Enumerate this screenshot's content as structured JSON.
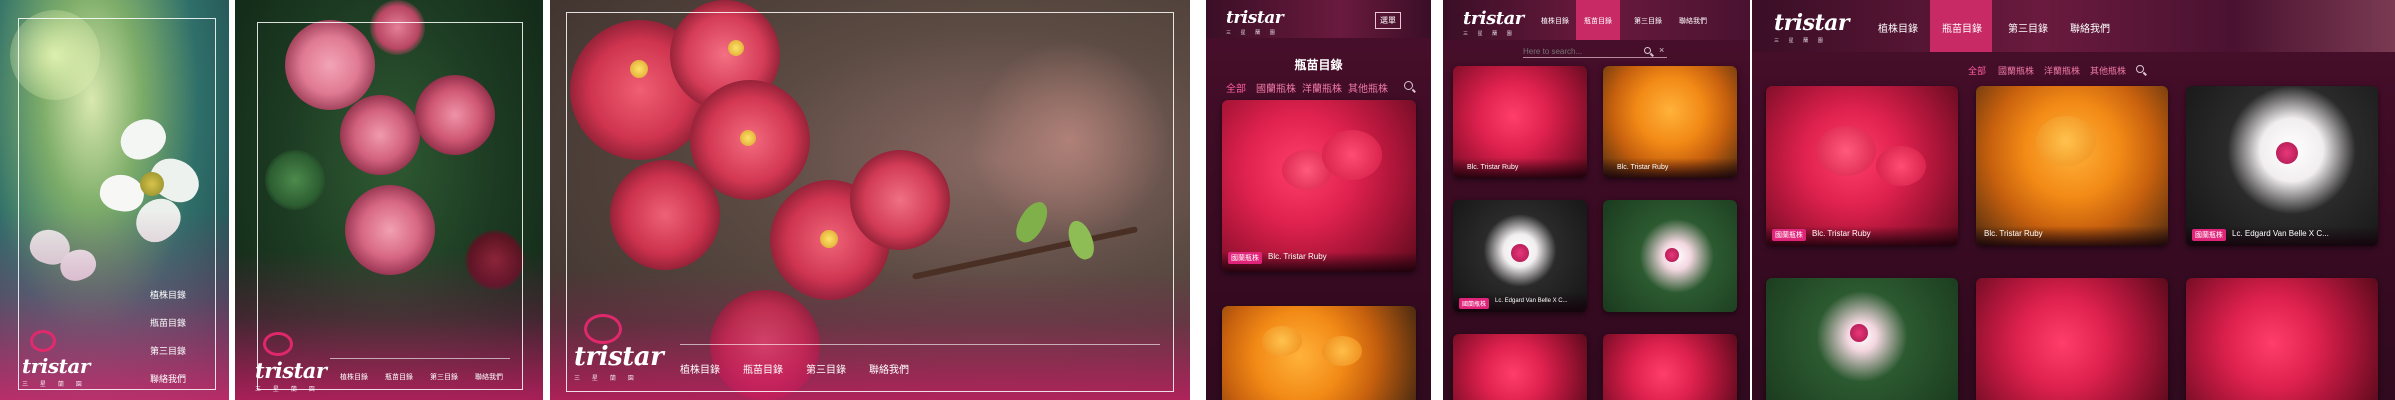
{
  "brand": {
    "name": "tristar",
    "subtitle": "三 星 蘭 園"
  },
  "panels": {
    "p1": {
      "menu": [
        "植株目錄",
        "瓶苗目錄",
        "第三目錄",
        "聯絡我們"
      ]
    },
    "p2": {
      "menu": [
        "植株目錄",
        "瓶苗目錄",
        "第三目錄",
        "聯絡我們"
      ]
    },
    "p3": {
      "menu": [
        "植株目錄",
        "瓶苗目錄",
        "第三目錄",
        "聯絡我們"
      ]
    },
    "p4": {
      "menu_button": "選單",
      "page_title": "瓶苗目錄",
      "categories": [
        "全部",
        "國蘭瓶株",
        "洋蘭瓶株",
        "其他瓶株"
      ],
      "cards": [
        {
          "badge": "國蘭瓶株",
          "name": "Blc. Tristar Ruby"
        }
      ]
    },
    "p5": {
      "menu": [
        "植株目錄",
        "瓶苗目錄",
        "第三目錄",
        "聯絡我們"
      ],
      "active_menu": "瓶苗目錄",
      "search_placeholder": "Here to search...",
      "cards": [
        {
          "badge": "",
          "name": "Blc. Tristar Ruby"
        },
        {
          "badge": "",
          "name": "Blc. Tristar Ruby"
        },
        {
          "badge": "國蘭瓶株",
          "name": "Lc. Edgard Van Belle X C..."
        }
      ]
    },
    "p6": {
      "menu": [
        "植株目錄",
        "瓶苗目錄",
        "第三目錄",
        "聯絡我們"
      ],
      "active_menu": "瓶苗目錄",
      "categories": [
        "全部",
        "國蘭瓶株",
        "洋蘭瓶株",
        "其他瓶株"
      ],
      "cards": [
        {
          "badge": "國蘭瓶株",
          "name": "Blc. Tristar Ruby"
        },
        {
          "badge": "",
          "name": "Blc. Tristar Ruby"
        },
        {
          "badge": "國蘭瓶株",
          "name": "Lc. Edgard Van Belle X C..."
        }
      ]
    }
  },
  "colors": {
    "accent": "#e0247a",
    "dark_bg": "#3a0a24",
    "panel_bg": "#5a1236"
  }
}
